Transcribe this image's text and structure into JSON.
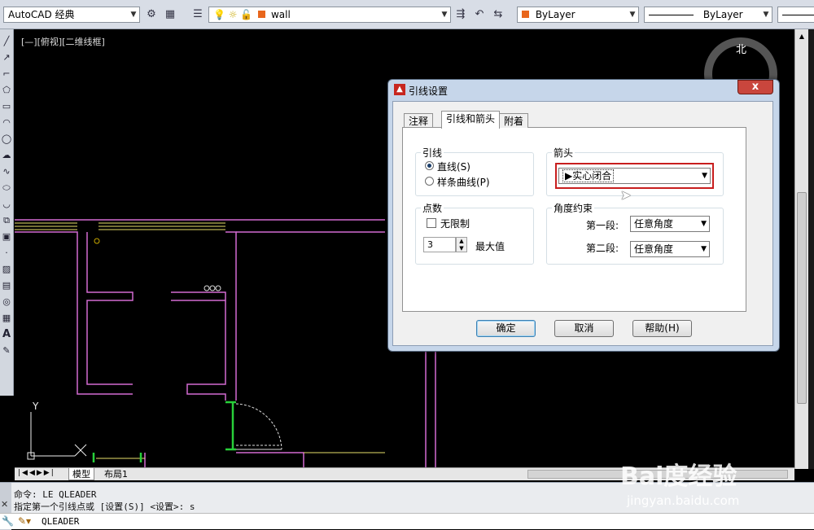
{
  "toolbar": {
    "workspace": "AutoCAD 经典",
    "layer": "wall",
    "color": "ByLayer",
    "linetype": "ByLayer",
    "layer_color": "#e8661c"
  },
  "viewport": {
    "label": "[—][俯视][二维线框]",
    "compass": "北"
  },
  "tabs": {
    "model": "模型",
    "layout1": "布局1"
  },
  "command": {
    "history1": "命令: LE QLEADER",
    "history2": "指定第一个引线点或 [设置(S)] <设置>: s",
    "current": "QLEADER"
  },
  "dialog": {
    "title": "引线设置",
    "close": "x",
    "tabs": [
      "注释",
      "引线和箭头",
      "附着"
    ],
    "leader": {
      "label": "引线",
      "straight": "直线(S)",
      "spline": "样条曲线(P)"
    },
    "points": {
      "label": "点数",
      "unlimited": "无限制",
      "value": "3",
      "max": "最大值"
    },
    "arrow": {
      "label": "箭头",
      "value": "▶实心闭合"
    },
    "angle": {
      "label": "角度约束",
      "first": "第一段:",
      "first_value": "任意角度",
      "second": "第二段:",
      "second_value": "任意角度"
    },
    "buttons": {
      "ok": "确定",
      "cancel": "取消",
      "help": "帮助(H)"
    }
  },
  "watermark": {
    "brand": "Bai度经验",
    "url": "jingyan.baidu.com"
  }
}
